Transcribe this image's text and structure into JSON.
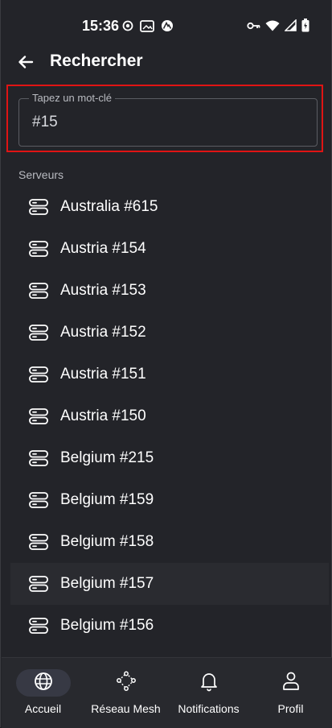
{
  "status_bar": {
    "time": "15:36",
    "left_icons": [
      "record-icon",
      "image-icon",
      "nordvpn-icon"
    ],
    "right_icons": [
      "key-icon",
      "wifi-icon",
      "signal-icon",
      "battery-icon"
    ]
  },
  "app_bar": {
    "title": "Rechercher"
  },
  "search": {
    "label": "Tapez un mot-clé",
    "value": "#15"
  },
  "section": {
    "title": "Serveurs"
  },
  "servers": [
    "Australia #615",
    "Austria #154",
    "Austria #153",
    "Austria #152",
    "Austria #151",
    "Austria #150",
    "Belgium #215",
    "Belgium #159",
    "Belgium #158",
    "Belgium #157",
    "Belgium #156"
  ],
  "bottom_nav": [
    {
      "label": "Accueil",
      "icon": "globe-icon",
      "active": true
    },
    {
      "label": "Réseau Mesh",
      "icon": "mesh-network-icon",
      "active": false
    },
    {
      "label": "Notifications",
      "icon": "bell-icon",
      "active": false
    },
    {
      "label": "Profil",
      "icon": "user-icon",
      "active": false
    }
  ],
  "colors": {
    "background": "#232429",
    "highlight_border": "#e01414",
    "nav_background": "#28292e",
    "active_pill": "#373944"
  }
}
